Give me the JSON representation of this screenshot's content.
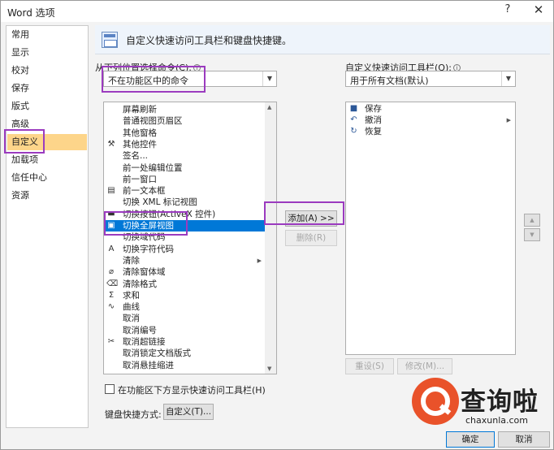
{
  "window": {
    "title": "Word 选项",
    "help_label": "?",
    "close_label": "✕"
  },
  "nav": {
    "items": [
      {
        "label": "常用",
        "selected": false
      },
      {
        "label": "显示",
        "selected": false
      },
      {
        "label": "校对",
        "selected": false
      },
      {
        "label": "保存",
        "selected": false
      },
      {
        "label": "版式",
        "selected": false
      },
      {
        "label": "高级",
        "selected": false
      },
      {
        "label": "自定义",
        "selected": true
      },
      {
        "label": "加载项",
        "selected": false
      },
      {
        "label": "信任中心",
        "selected": false
      },
      {
        "label": "资源",
        "selected": false
      }
    ]
  },
  "header": {
    "text": "自定义快速访问工具栏和键盘快捷键。",
    "icon": "toolbar-icon"
  },
  "left_panel": {
    "choose_label": "从下列位置选择命令(C):",
    "choose_value": "不在功能区中的命令",
    "commands": [
      {
        "label": "屏幕刷新",
        "icon": "",
        "selected": false,
        "submenu": false
      },
      {
        "label": "普通视图页眉区",
        "icon": "",
        "selected": false,
        "submenu": false
      },
      {
        "label": "其他窗格",
        "icon": "",
        "selected": false,
        "submenu": false
      },
      {
        "label": "其他控件",
        "icon": "⚒",
        "selected": false,
        "submenu": false
      },
      {
        "label": "签名...",
        "icon": "",
        "selected": false,
        "submenu": false
      },
      {
        "label": "前一处编辑位置",
        "icon": "",
        "selected": false,
        "submenu": false
      },
      {
        "label": "前一窗口",
        "icon": "",
        "selected": false,
        "submenu": false
      },
      {
        "label": "前一文本框",
        "icon": "▤",
        "selected": false,
        "submenu": false
      },
      {
        "label": "切换 XML 标记视图",
        "icon": "",
        "selected": false,
        "submenu": false
      },
      {
        "label": "切换按钮(ActiveX 控件)",
        "icon": "▬",
        "selected": false,
        "submenu": false
      },
      {
        "label": "切换全屏视图",
        "icon": "▣",
        "selected": true,
        "submenu": false
      },
      {
        "label": "切换域代码",
        "icon": "",
        "selected": false,
        "submenu": false
      },
      {
        "label": "切换字符代码",
        "icon": "A",
        "selected": false,
        "submenu": false
      },
      {
        "label": "清除",
        "icon": "",
        "selected": false,
        "submenu": true
      },
      {
        "label": "清除窗体域",
        "icon": "⌀",
        "selected": false,
        "submenu": false
      },
      {
        "label": "清除格式",
        "icon": "⌫",
        "selected": false,
        "submenu": false
      },
      {
        "label": "求和",
        "icon": "Σ",
        "selected": false,
        "submenu": false
      },
      {
        "label": "曲线",
        "icon": "∿",
        "selected": false,
        "submenu": false
      },
      {
        "label": "取消",
        "icon": "",
        "selected": false,
        "submenu": false
      },
      {
        "label": "取消编号",
        "icon": "",
        "selected": false,
        "submenu": false
      },
      {
        "label": "取消超链接",
        "icon": "✂",
        "selected": false,
        "submenu": false
      },
      {
        "label": "取消锁定文档版式",
        "icon": "",
        "selected": false,
        "submenu": false
      },
      {
        "label": "取消悬挂缩进",
        "icon": "",
        "selected": false,
        "submenu": false
      }
    ],
    "show_below_label": "在功能区下方显示快速访问工具栏(H)",
    "keyboard_label": "键盘快捷方式:",
    "customize_button": "自定义(T)..."
  },
  "middle": {
    "add_button": "添加(A) >>",
    "remove_button": "删除(R)"
  },
  "right_panel": {
    "qat_label": "自定义快速访问工具栏(Q):",
    "qat_value": "用于所有文档(默认)",
    "items": [
      {
        "label": "保存",
        "icon": "save-icon",
        "glyph": "■",
        "submenu": false
      },
      {
        "label": "撤消",
        "icon": "undo-icon",
        "glyph": "↶",
        "submenu": true
      },
      {
        "label": "恢复",
        "icon": "redo-icon",
        "glyph": "↻",
        "submenu": false
      }
    ],
    "reset_button": "重设(S)",
    "modify_button": "修改(M)...",
    "up_arrow": "▲",
    "down_arrow": "▼"
  },
  "footer": {
    "ok_button": "确定",
    "cancel_button": "取消"
  },
  "watermark": {
    "brand": "查询啦",
    "url": "chaxunla.com"
  },
  "colors": {
    "selection": "#0078d7",
    "nav_selected": "#fdd58a",
    "highlight_box": "#9b3bbf",
    "watermark": "#e9522a"
  }
}
